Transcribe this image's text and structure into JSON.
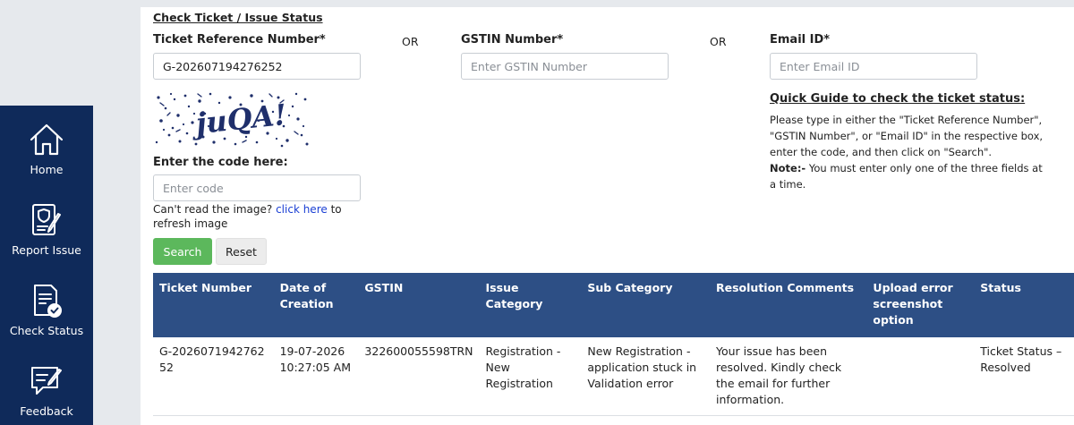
{
  "sidebar": {
    "items": [
      {
        "label": "Home",
        "icon": "home-icon"
      },
      {
        "label": "Report Issue",
        "icon": "report-issue-icon"
      },
      {
        "label": "Check Status",
        "icon": "check-status-icon"
      },
      {
        "label": "Feedback",
        "icon": "feedback-icon"
      }
    ]
  },
  "form": {
    "title": "Check Ticket / Issue Status",
    "ticket_label": "Ticket Reference Number*",
    "ticket_value": "G-202607194276252",
    "or1": "OR",
    "gstin_label": "GSTIN Number*",
    "gstin_placeholder": "Enter GSTIN Number",
    "or2": "OR",
    "email_label": "Email ID*",
    "email_placeholder": "Enter Email ID",
    "captcha_text": "juQA!",
    "code_label": "Enter the code here:",
    "code_placeholder": "Enter code",
    "refresh_prefix": "Can't read the image?",
    "refresh_link": "click here",
    "refresh_suffix": "to refresh image",
    "search_label": "Search",
    "reset_label": "Reset"
  },
  "guide": {
    "title": "Quick Guide to check the ticket status:",
    "text": "Please type in either the \"Ticket Reference Number\", \"GSTIN Number\", or \"Email ID\" in the respective box, enter the code, and then click on \"Search\".",
    "note_label": "Note:-",
    "note_text": "You must enter only one of the three fields at a time."
  },
  "table": {
    "headers": [
      "Ticket Number",
      "Date of Creation",
      "GSTIN",
      "Issue Category",
      "Sub Category",
      "Resolution Comments",
      "Upload error screenshot option",
      "Status"
    ],
    "rows": [
      [
        "G-202607194276252",
        "19-07-2026 10:27:05 AM",
        "322600055598TRN",
        "Registration - New Registration",
        "New Registration - application stuck in Validation error",
        "Your issue has been resolved. Kindly check the email for further information.",
        "",
        "Ticket Status – Resolved"
      ]
    ]
  },
  "colors": {
    "sidebar_bg": "#0f2a5a",
    "table_header_bg": "#2d4f85",
    "search_button": "#5cb85c",
    "link": "#1a3fd4"
  }
}
